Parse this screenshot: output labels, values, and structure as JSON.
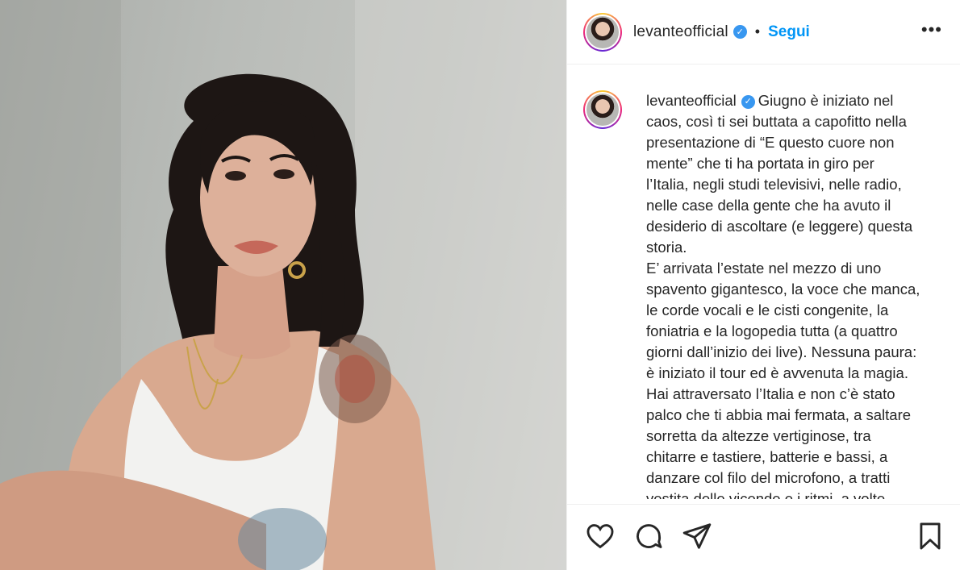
{
  "header": {
    "username": "levanteofficial",
    "separator": "•",
    "follow_label": "Segui",
    "more_label": "•••"
  },
  "caption": {
    "username": "levanteofficial",
    "lines": [
      "Giugno è iniziato nel",
      "caos, così ti sei buttata a capofitto nella",
      "presentazione di “E questo cuore non",
      "mente” che ti ha portata in giro per",
      "l’Italia, negli studi televisivi, nelle radio,",
      "nelle case della gente che ha avuto il",
      "desiderio di ascoltare (e leggere) questa",
      "storia.",
      "E’ arrivata l’estate nel mezzo di uno",
      "spavento gigantesco, la voce che manca,",
      "le corde vocali e le cisti congenite, la",
      "foniatria e la logopedia tutta (a quattro",
      "giorni dall’inizio dei live). Nessuna paura:",
      "è iniziato il tour ed è avvenuta la magia.",
      "Hai attraversato l’Italia e non c’è stato",
      "palco che ti abbia mai fermata, a saltare",
      "sorretta da altezze vertiginose, tra",
      "chitarre e tastiere, batterie e bassi, a",
      "danzare col filo del microfono, a tratti",
      "vestita delle vicende e i ritmi, a volte"
    ]
  },
  "actions": {
    "like": "heart-icon",
    "comment": "comment-icon",
    "share": "paper-plane-icon",
    "save": "bookmark-icon"
  },
  "colors": {
    "follow": "#0095f6",
    "verified": "#3897f0",
    "text": "#262626",
    "divider": "#efefef"
  }
}
